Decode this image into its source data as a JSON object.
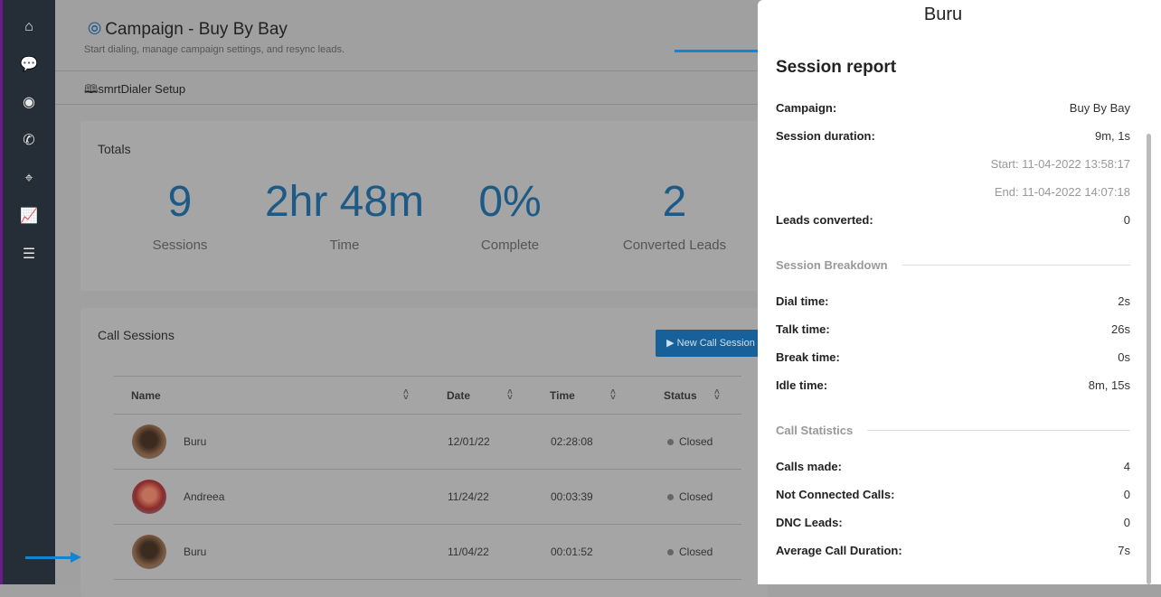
{
  "sidebar": {
    "items": [
      {
        "icon": "home-icon",
        "glyph": "⌂"
      },
      {
        "icon": "chat-icon",
        "glyph": "💬"
      },
      {
        "icon": "eye-icon",
        "glyph": "◉"
      },
      {
        "icon": "phone-icon",
        "glyph": "✆"
      },
      {
        "icon": "target-icon",
        "glyph": "⌖"
      },
      {
        "icon": "chart-icon",
        "glyph": "📈"
      },
      {
        "icon": "sliders-icon",
        "glyph": "☰"
      }
    ]
  },
  "header": {
    "title": "Campaign - Buy By Bay",
    "subtitle": "Start dialing, manage campaign settings, and resync leads.",
    "setup_link": "smrtDialer Setup"
  },
  "totals": {
    "title": "Totals",
    "stats": [
      {
        "value": "9",
        "label": "Sessions"
      },
      {
        "value": "2hr 48m",
        "label": "Time"
      },
      {
        "value": "0%",
        "label": "Complete"
      },
      {
        "value": "2",
        "label": "Converted Leads"
      }
    ]
  },
  "sessions": {
    "title": "Call Sessions",
    "new_button": "New Call Session",
    "columns": [
      "Name",
      "Date",
      "Time",
      "Status"
    ],
    "rows": [
      {
        "name": "Buru",
        "date": "12/01/22",
        "time": "02:28:08",
        "status": "Closed"
      },
      {
        "name": "Andreea",
        "date": "11/24/22",
        "time": "00:03:39",
        "status": "Closed"
      },
      {
        "name": "Buru",
        "date": "11/04/22",
        "time": "00:01:52",
        "status": "Closed"
      }
    ]
  },
  "panel": {
    "name": "Buru",
    "heading": "Session report",
    "campaign_label": "Campaign:",
    "campaign": "Buy By Bay",
    "duration_label": "Session duration:",
    "duration": "9m, 1s",
    "start": "Start: 11-04-2022 13:58:17",
    "end": "End: 11-04-2022 14:07:18",
    "leads_label": "Leads converted:",
    "leads": "0",
    "breakdown_title": "Session Breakdown",
    "breakdown": [
      {
        "k": "Dial time:",
        "v": "2s"
      },
      {
        "k": "Talk time:",
        "v": "26s"
      },
      {
        "k": "Break time:",
        "v": "0s"
      },
      {
        "k": "Idle time:",
        "v": "8m, 15s"
      }
    ],
    "stats_title": "Call Statistics",
    "stats": [
      {
        "k": "Calls made:",
        "v": "4"
      },
      {
        "k": "Not Connected Calls:",
        "v": "0"
      },
      {
        "k": "DNC Leads:",
        "v": "0"
      },
      {
        "k": "Average Call Duration:",
        "v": "7s"
      }
    ]
  },
  "colors": {
    "accent": "#17609a",
    "sidebar": "#252e36",
    "annotation_arrow": "#1684cc"
  }
}
